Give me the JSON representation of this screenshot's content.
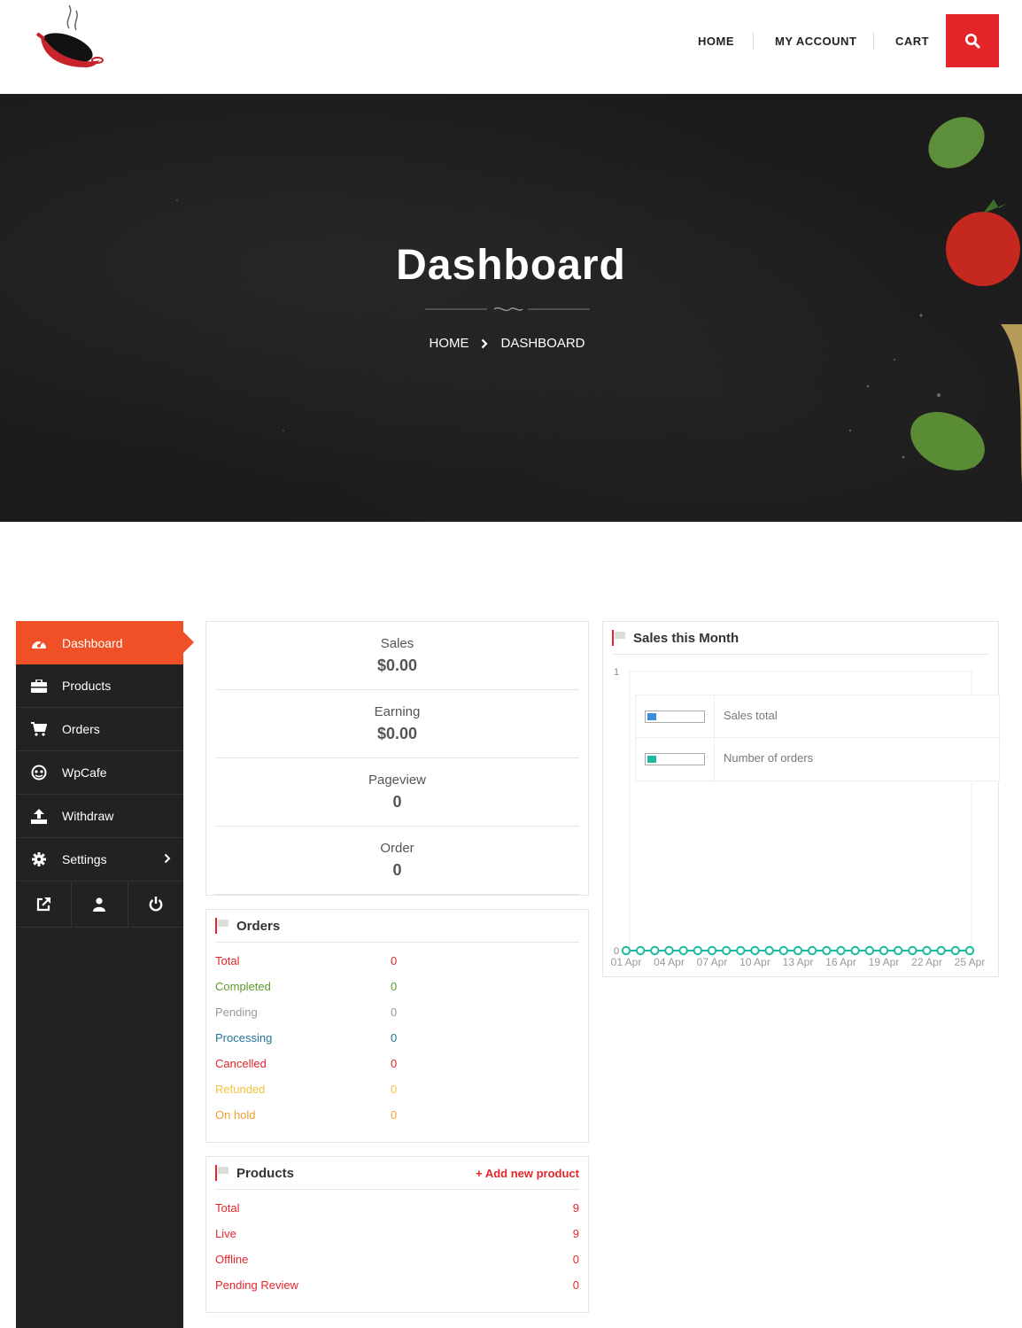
{
  "header": {
    "nav": [
      "HOME",
      "MY ACCOUNT",
      "CART"
    ],
    "search_icon": "search-icon"
  },
  "hero": {
    "title": "Dashboard",
    "breadcrumb": [
      "HOME",
      "DASHBOARD"
    ]
  },
  "sidebar": {
    "items": [
      {
        "label": "Dashboard",
        "icon": "dashboard-icon"
      },
      {
        "label": "Products",
        "icon": "briefcase-icon"
      },
      {
        "label": "Orders",
        "icon": "cart-icon"
      },
      {
        "label": "WpCafe",
        "icon": "chef-icon"
      },
      {
        "label": "Withdraw",
        "icon": "upload-icon"
      },
      {
        "label": "Settings",
        "icon": "gear-icon"
      }
    ],
    "bottom_icons": [
      "external-link-icon",
      "user-icon",
      "power-icon"
    ]
  },
  "stats": [
    {
      "label": "Sales",
      "value": "$0.00"
    },
    {
      "label": "Earning",
      "value": "$0.00"
    },
    {
      "label": "Pageview",
      "value": "0"
    },
    {
      "label": "Order",
      "value": "0"
    }
  ],
  "orders": {
    "title": "Orders",
    "rows": [
      {
        "label": "Total",
        "value": "0",
        "color": "#e4252a"
      },
      {
        "label": "Completed",
        "value": "0",
        "color": "#5e9a2c"
      },
      {
        "label": "Pending",
        "value": "0",
        "color": "#999999"
      },
      {
        "label": "Processing",
        "value": "0",
        "color": "#21759b"
      },
      {
        "label": "Cancelled",
        "value": "0",
        "color": "#e4252a"
      },
      {
        "label": "Refunded",
        "value": "0",
        "color": "#f0c43a"
      },
      {
        "label": "On hold",
        "value": "0",
        "color": "#f0a030"
      }
    ]
  },
  "products": {
    "title": "Products",
    "add_label": "+ Add new product",
    "rows": [
      {
        "label": "Total",
        "value": "9"
      },
      {
        "label": "Live",
        "value": "9"
      },
      {
        "label": "Offline",
        "value": "0"
      },
      {
        "label": "Pending Review",
        "value": "0"
      }
    ]
  },
  "chart": {
    "title": "Sales this Month"
  },
  "chart_data": {
    "type": "line",
    "title": "Sales this Month",
    "x": [
      "01 Apr",
      "02 Apr",
      "03 Apr",
      "04 Apr",
      "05 Apr",
      "06 Apr",
      "07 Apr",
      "08 Apr",
      "09 Apr",
      "10 Apr",
      "11 Apr",
      "12 Apr",
      "13 Apr",
      "14 Apr",
      "15 Apr",
      "16 Apr",
      "17 Apr",
      "18 Apr",
      "19 Apr",
      "20 Apr",
      "21 Apr",
      "22 Apr",
      "23 Apr",
      "24 Apr",
      "25 Apr"
    ],
    "tick_labels": [
      "01 Apr",
      "04 Apr",
      "07 Apr",
      "10 Apr",
      "13 Apr",
      "16 Apr",
      "19 Apr",
      "22 Apr",
      "25 Apr"
    ],
    "series": [
      {
        "name": "Sales total",
        "color": "#3c8dde",
        "values": [
          0,
          0,
          0,
          0,
          0,
          0,
          0,
          0,
          0,
          0,
          0,
          0,
          0,
          0,
          0,
          0,
          0,
          0,
          0,
          0,
          0,
          0,
          0,
          0,
          0
        ]
      },
      {
        "name": "Number of orders",
        "color": "#1abc9c",
        "values": [
          0,
          0,
          0,
          0,
          0,
          0,
          0,
          0,
          0,
          0,
          0,
          0,
          0,
          0,
          0,
          0,
          0,
          0,
          0,
          0,
          0,
          0,
          0,
          0,
          0
        ]
      }
    ],
    "ylim": [
      0,
      1
    ],
    "yticks": [
      "0",
      "1"
    ],
    "legend": "top-left"
  }
}
